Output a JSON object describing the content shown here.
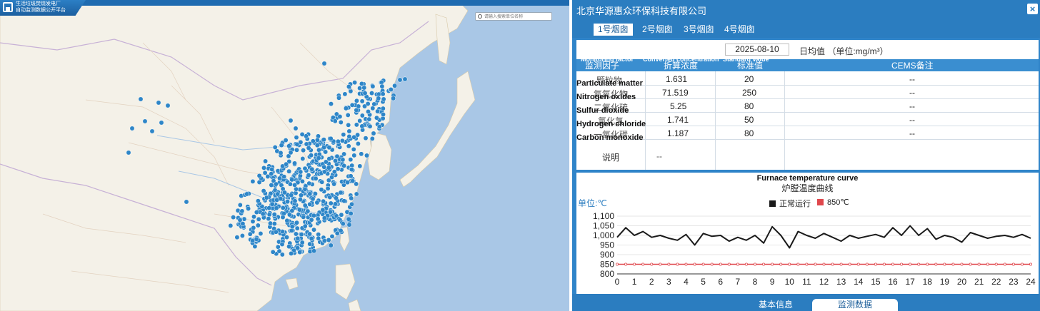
{
  "map": {
    "title_line1": "生活垃圾焚烧发电厂",
    "title_line2": "自动监测数据公开平台",
    "search_placeholder": "请输入搜索单位名称",
    "marker_color": "#2e86c8"
  },
  "panel": {
    "company": "北京华源惠众环保科技有限公司",
    "close_glyph": "×",
    "tabs": [
      "1号烟囱",
      "2号烟囱",
      "3号烟囱",
      "4号烟囱"
    ],
    "active_tab": 0,
    "date": "2025-08-10",
    "unit_text": "日均值 （单位:mg/m³）",
    "table": {
      "headers_en": [
        "Monitoring factor",
        "Converted concentration",
        "Standard value"
      ],
      "headers": [
        "监测因子",
        "折算浓度",
        "标准值",
        "CEMS备注"
      ],
      "rows": [
        {
          "name": "颗粒物",
          "name_en": "Particulate matter",
          "value": "1.631",
          "standard": "20",
          "note": "--"
        },
        {
          "name": "氮氧化物",
          "name_en": "Nitrogen oxides",
          "value": "71.519",
          "standard": "250",
          "note": "--"
        },
        {
          "name": "二氧化硫",
          "name_en": "Sulfur dioxide",
          "value": "5.25",
          "standard": "80",
          "note": "--"
        },
        {
          "name": "氯化氢",
          "name_en": "Hydrogen chloride",
          "value": "1.741",
          "standard": "50",
          "note": "--"
        },
        {
          "name": "一氧化碳",
          "name_en": "Carbon monoxide",
          "value": "1.187",
          "standard": "80",
          "note": "--"
        }
      ],
      "note_label": "说明",
      "note_value": "--"
    },
    "chart": {
      "title_en": "Furnace temperature curve",
      "title": "炉膛温度曲线",
      "unit": "单位:℃",
      "legend": [
        {
          "label": "正常运行",
          "color": "#1a1a1a"
        },
        {
          "label": "850℃",
          "color": "#e0474c"
        }
      ]
    },
    "footer_tabs": [
      "基本信息",
      "监测数据"
    ],
    "active_footer_tab": 1
  },
  "chart_data": {
    "type": "line",
    "title": "炉膛温度曲线",
    "ylabel": "单位:℃",
    "ylim": [
      800,
      1100
    ],
    "yticks": [
      "1,100",
      "1,050",
      "1,000",
      "950",
      "900",
      "850",
      "800"
    ],
    "xticks": [
      "0",
      "1",
      "2",
      "3",
      "4",
      "5",
      "6",
      "7",
      "8",
      "9",
      "10",
      "11",
      "12",
      "13",
      "14",
      "15",
      "16",
      "17",
      "18",
      "19",
      "20",
      "21",
      "22",
      "23",
      "24"
    ],
    "series": [
      {
        "name": "正常运行",
        "color": "#1a1a1a",
        "x": [
          0,
          0.5,
          1,
          1.5,
          2,
          2.5,
          3,
          3.5,
          4,
          4.5,
          5,
          5.5,
          6,
          6.5,
          7,
          7.5,
          8,
          8.5,
          9,
          9.5,
          10,
          10.5,
          11,
          11.5,
          12,
          12.5,
          13,
          13.5,
          14,
          14.5,
          15,
          15.5,
          16,
          16.5,
          17,
          17.5,
          18,
          18.5,
          19,
          19.5,
          20,
          20.5,
          21,
          21.5,
          22,
          22.5,
          23,
          23.5,
          24
        ],
        "values": [
          990,
          1040,
          1000,
          1020,
          990,
          1000,
          985,
          975,
          1005,
          950,
          1010,
          995,
          1000,
          970,
          990,
          975,
          1000,
          960,
          1045,
          1000,
          935,
          1020,
          1000,
          985,
          1010,
          990,
          970,
          1000,
          985,
          995,
          1005,
          990,
          1040,
          1000,
          1050,
          1000,
          1035,
          980,
          1000,
          990,
          965,
          1015,
          1000,
          985,
          995,
          1000,
          990,
          1005,
          985
        ]
      },
      {
        "name": "850℃",
        "color": "#e0474c",
        "x": [
          0,
          24
        ],
        "values": [
          850,
          850
        ]
      }
    ]
  }
}
